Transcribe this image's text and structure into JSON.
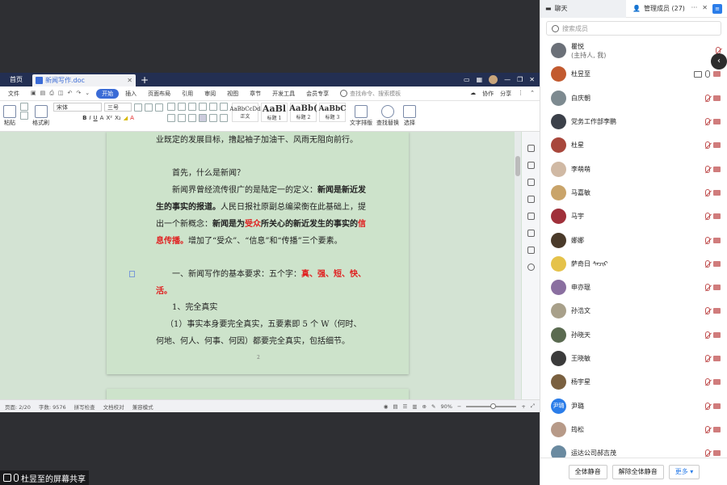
{
  "share_bar": {
    "label": "杜昱至的屏幕共享"
  },
  "wps": {
    "tabs": {
      "home": "首页",
      "doc_title": "新闻写作.doc"
    },
    "menu": [
      "文件",
      "开始",
      "插入",
      "页面布局",
      "引用",
      "审阅",
      "视图",
      "章节",
      "开发工具",
      "会员专享"
    ],
    "active_menu": "开始",
    "search_placeholder": "查找命令、搜索模板",
    "menu_right": [
      "协作",
      "分享"
    ],
    "ribbon": {
      "paste": "粘贴",
      "format_painter": "格式刷",
      "font": "宋体",
      "size": "三号",
      "styles": [
        {
          "sample": "AaBbCcDd",
          "label": "正文"
        },
        {
          "sample": "AaBl",
          "label": "标题 1"
        },
        {
          "sample": "AaBb(",
          "label": "标题 2"
        },
        {
          "sample": "AaBbC",
          "label": "标题 3"
        }
      ],
      "text_layout": "文字排版",
      "find_replace": "查找替换",
      "select": "选择"
    },
    "doc": {
      "line1": "业既定的发展目标，撸起袖子加油干、风雨无阻向前行。",
      "q": "首先，什么是新闻？",
      "p2a": "新闻界曾经流传很广的是陆定一的定义：",
      "p2b": "新闻是新近发",
      "p2c": "生的事实的报道。",
      "p2d": "人民日报社原副总编梁衡在此基础上，提",
      "p2e": "出一个新概念：",
      "p2f": "新闻是为",
      "p2g": "受众",
      "p2h": "所关心的新近发生的事实的",
      "p2i": "信",
      "p2j": "息传播。",
      "p2k": "增加了“受众”、“信息”和“传播”三个要素。",
      "h1a": "一、新闻写作的基本要求：五个字：",
      "h1b": "真、强、短、快、",
      "h1c": "活。",
      "h2": "1、完全真实",
      "p3a": "（1）事实本身要完全真实，五要素即 5 个 W（何时、何",
      "p3b": "地、何人、何事、何因）都要完全真实，包括细节。",
      "page_num": "2"
    },
    "status": {
      "page": "页面: 2/20",
      "words": "字数: 9576",
      "spell": "拼写检查",
      "proof": "文档校对",
      "protect": "兼容模式",
      "zoom": "90%",
      "zoom_level": 0.5
    }
  },
  "panel": {
    "tab_chat": "聊天",
    "tab_members": "管理成员 (27)",
    "search_placeholder": "搜索成员",
    "members": [
      {
        "name": "瞿悦",
        "sub": "(主持人, 我)",
        "color": "#6b7078",
        "state": "host"
      },
      {
        "name": "杜昱至",
        "color": "#c25a2f",
        "state": "sharing"
      },
      {
        "name": "白庆朝",
        "color": "#7d8a90",
        "state": "off"
      },
      {
        "name": "党务工作部李鹏",
        "color": "#3b4049",
        "state": "off"
      },
      {
        "name": "杜星",
        "color": "#a8473c",
        "state": "off"
      },
      {
        "name": "李萌萌",
        "color": "#d0b9a4",
        "state": "off"
      },
      {
        "name": "马嘉敏",
        "color": "#c9a46a",
        "state": "off"
      },
      {
        "name": "马宇",
        "color": "#a0303a",
        "state": "off"
      },
      {
        "name": "娜娜",
        "color": "#4a3a2a",
        "state": "off"
      },
      {
        "name": "萨奇日 ᠰᠠᠴᠢᠷ",
        "color": "#e5c24a",
        "state": "off"
      },
      {
        "name": "申亦琨",
        "color": "#8a6fa0",
        "state": "off"
      },
      {
        "name": "孙浩文",
        "color": "#a8a08a",
        "state": "off"
      },
      {
        "name": "孙晓天",
        "color": "#5a6a50",
        "state": "off"
      },
      {
        "name": "王晓敏",
        "color": "#3b3b3b",
        "state": "off"
      },
      {
        "name": "杨宇星",
        "color": "#7a6040",
        "state": "off"
      },
      {
        "name": "尹璐",
        "initial": "尹璐",
        "color": "#2b7de9",
        "state": "off"
      },
      {
        "name": "筠松",
        "color": "#b79a88",
        "state": "off"
      },
      {
        "name": "运达公司郝吉茂",
        "color": "#6a8aa0",
        "state": "off"
      }
    ],
    "mute_all": "全体静音",
    "unmute_all": "解除全体静音",
    "more": "更多"
  }
}
